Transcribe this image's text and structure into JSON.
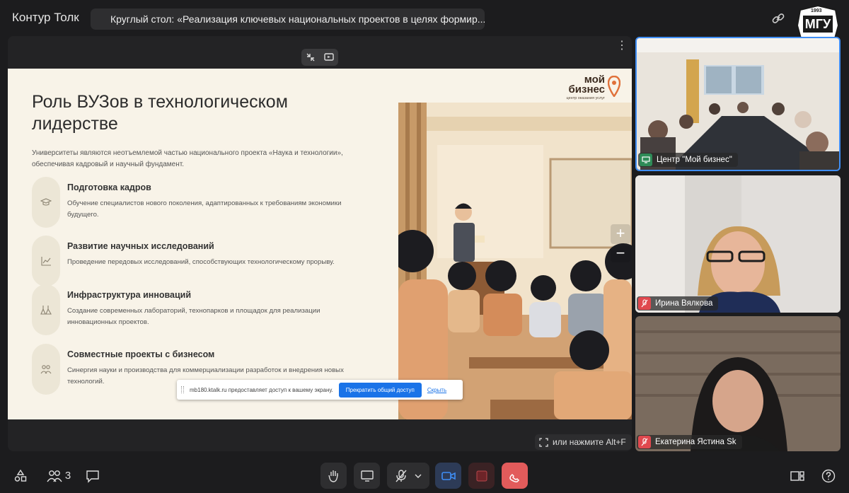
{
  "app": {
    "title": "Контур Толк"
  },
  "meeting": {
    "title": "Круглый стол: «Реализация ключевых национальных проектов в целях формир..."
  },
  "slide": {
    "title": "Роль ВУЗов в технологическом лидерстве",
    "intro": "Университеты являются неотъемлемой частью национального проекта «Наука и технологии», обеспечивая кадровый и научный фундамент.",
    "items": [
      {
        "icon": "graduation-cap-icon",
        "heading": "Подготовка кадров",
        "text": "Обучение специалистов нового поколения, адаптированных к требованиям экономики будущего."
      },
      {
        "icon": "chart-icon",
        "heading": "Развитие научных исследований",
        "text": "Проведение передовых исследований, способствующих технологическому прорыву."
      },
      {
        "icon": "flask-icon",
        "heading": "Инфраструктура инноваций",
        "text": "Создание современных лабораторий, технопарков и площадок для реализации инновационных проектов."
      },
      {
        "icon": "people-icon",
        "heading": "Совместные проекты с бизнесом",
        "text": "Синергия науки и производства для коммерциализации разработок и внедрения новых технологий."
      }
    ],
    "logo_line1": "мой",
    "logo_line2": "бизнес",
    "logo_sub": "центр оказания услуг"
  },
  "share_bar": {
    "message": "mb180.ktalk.ru предоставляет доступ к вашему экрану.",
    "stop_label": "Прекратить общий доступ",
    "hide_label": "Скрыть"
  },
  "shortcut_hint": "или нажмите Alt+F",
  "logo_mgu": {
    "year": "1993",
    "text": "МГУ"
  },
  "participants": [
    {
      "name": "Центр \"Мой бизнес\"",
      "mic": "active",
      "accent": "#3f8ef5"
    },
    {
      "name": "Ирина Вялкова",
      "mic": "muted"
    },
    {
      "name": "Екатерина Ястина Sk",
      "mic": "muted"
    }
  ],
  "toolbar": {
    "participants_count": "3"
  },
  "colors": {
    "muted_badge": "#e0484e",
    "camera_active": "#3f8ef5",
    "end_call": "#e25b5b",
    "stop_record": "#5a2326"
  }
}
